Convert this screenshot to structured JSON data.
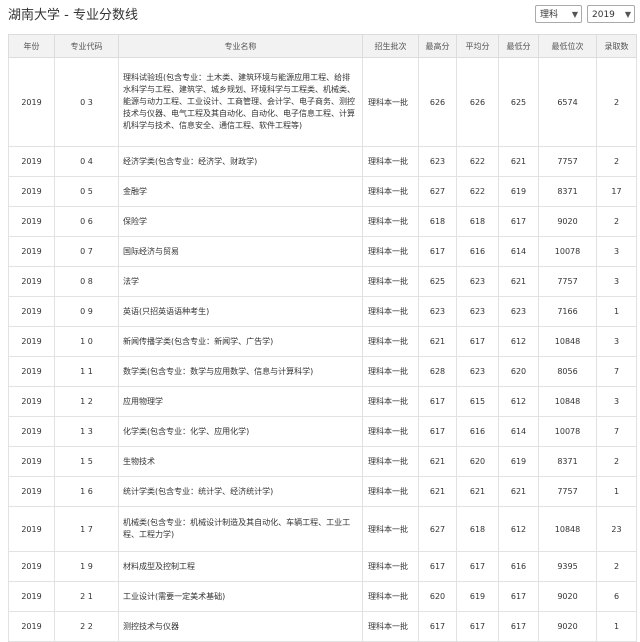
{
  "header": {
    "title": "湖南大学 - 专业分数线",
    "subject_select": "理科",
    "year_select": "2019"
  },
  "table": {
    "columns": [
      "年份",
      "专业代码",
      "专业名称",
      "招生批次",
      "最高分",
      "平均分",
      "最低分",
      "最低位次",
      "录取数"
    ],
    "rows": [
      {
        "year": "2019",
        "code": "0 3",
        "name": "理科试验班(包含专业：土木类、建筑环境与能源应用工程、给排水科学与工程、建筑学、城乡规划、环境科学与工程类、机械类、能源与动力工程、工业设计、工商管理、会计学、电子商务、测控技术与仪器、电气工程及其自动化、自动化、电子信息工程、计算机科学与技术、信息安全、通信工程、软件工程等)",
        "batch": "理科本一批",
        "max": "626",
        "avg": "626",
        "min": "625",
        "rank": "6574",
        "count": "2",
        "h": "tall"
      },
      {
        "year": "2019",
        "code": "0 4",
        "name": "经济学类(包含专业：经济学、财政学)",
        "batch": "理科本一批",
        "max": "623",
        "avg": "622",
        "min": "621",
        "rank": "7757",
        "count": "2",
        "h": ""
      },
      {
        "year": "2019",
        "code": "0 5",
        "name": "金融学",
        "batch": "理科本一批",
        "max": "627",
        "avg": "622",
        "min": "619",
        "rank": "8371",
        "count": "17",
        "h": ""
      },
      {
        "year": "2019",
        "code": "0 6",
        "name": "保险学",
        "batch": "理科本一批",
        "max": "618",
        "avg": "618",
        "min": "617",
        "rank": "9020",
        "count": "2",
        "h": ""
      },
      {
        "year": "2019",
        "code": "0 7",
        "name": "国际经济与贸易",
        "batch": "理科本一批",
        "max": "617",
        "avg": "616",
        "min": "614",
        "rank": "10078",
        "count": "3",
        "h": ""
      },
      {
        "year": "2019",
        "code": "0 8",
        "name": "法学",
        "batch": "理科本一批",
        "max": "625",
        "avg": "623",
        "min": "621",
        "rank": "7757",
        "count": "3",
        "h": ""
      },
      {
        "year": "2019",
        "code": "0 9",
        "name": "英语(只招英语语种考生)",
        "batch": "理科本一批",
        "max": "623",
        "avg": "623",
        "min": "623",
        "rank": "7166",
        "count": "1",
        "h": ""
      },
      {
        "year": "2019",
        "code": "1 0",
        "name": "新闻传播学类(包含专业：新闻学、广告学)",
        "batch": "理科本一批",
        "max": "621",
        "avg": "617",
        "min": "612",
        "rank": "10848",
        "count": "3",
        "h": ""
      },
      {
        "year": "2019",
        "code": "1 1",
        "name": "数学类(包含专业：数学与应用数学、信息与计算科学)",
        "batch": "理科本一批",
        "max": "628",
        "avg": "623",
        "min": "620",
        "rank": "8056",
        "count": "7",
        "h": ""
      },
      {
        "year": "2019",
        "code": "1 2",
        "name": "应用物理学",
        "batch": "理科本一批",
        "max": "617",
        "avg": "615",
        "min": "612",
        "rank": "10848",
        "count": "3",
        "h": ""
      },
      {
        "year": "2019",
        "code": "1 3",
        "name": "化学类(包含专业：化学、应用化学)",
        "batch": "理科本一批",
        "max": "617",
        "avg": "616",
        "min": "614",
        "rank": "10078",
        "count": "7",
        "h": ""
      },
      {
        "year": "2019",
        "code": "1 5",
        "name": "生物技术",
        "batch": "理科本一批",
        "max": "621",
        "avg": "620",
        "min": "619",
        "rank": "8371",
        "count": "2",
        "h": ""
      },
      {
        "year": "2019",
        "code": "1 6",
        "name": "统计学类(包含专业：统计学、经济统计学)",
        "batch": "理科本一批",
        "max": "621",
        "avg": "621",
        "min": "621",
        "rank": "7757",
        "count": "1",
        "h": ""
      },
      {
        "year": "2019",
        "code": "1 7",
        "name": "机械类(包含专业：机械设计制造及其自动化、车辆工程、工业工程、工程力学)",
        "batch": "理科本一批",
        "max": "627",
        "avg": "618",
        "min": "612",
        "rank": "10848",
        "count": "23",
        "h": "mid"
      },
      {
        "year": "2019",
        "code": "1 9",
        "name": "材料成型及控制工程",
        "batch": "理科本一批",
        "max": "617",
        "avg": "617",
        "min": "616",
        "rank": "9395",
        "count": "2",
        "h": ""
      },
      {
        "year": "2019",
        "code": "2 1",
        "name": "工业设计(需要一定美术基础)",
        "batch": "理科本一批",
        "max": "620",
        "avg": "619",
        "min": "617",
        "rank": "9020",
        "count": "6",
        "h": ""
      },
      {
        "year": "2019",
        "code": "2 2",
        "name": "测控技术与仪器",
        "batch": "理科本一批",
        "max": "617",
        "avg": "617",
        "min": "617",
        "rank": "9020",
        "count": "1",
        "h": ""
      }
    ]
  }
}
